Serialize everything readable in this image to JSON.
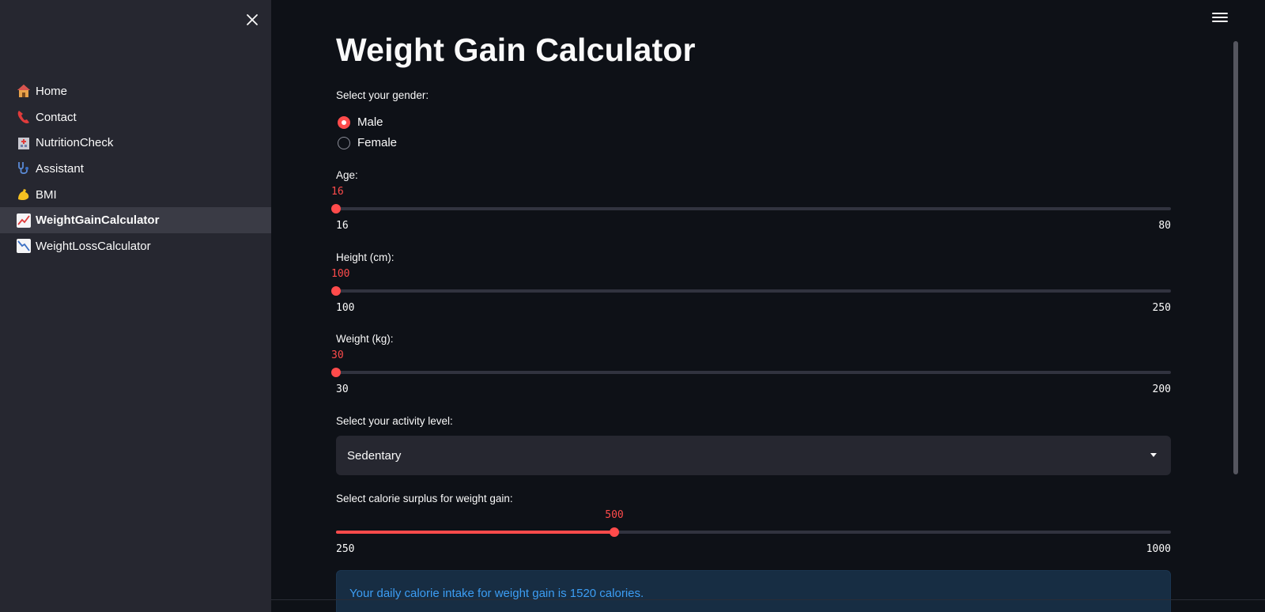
{
  "sidebar": {
    "items": [
      {
        "label": "Home",
        "icon": "house-icon",
        "active": false
      },
      {
        "label": "Contact",
        "icon": "telephone-icon",
        "active": false
      },
      {
        "label": "NutritionCheck",
        "icon": "hospital-icon",
        "active": false
      },
      {
        "label": "Assistant",
        "icon": "stethoscope-icon",
        "active": false
      },
      {
        "label": "BMI",
        "icon": "flexed-biceps-icon",
        "active": false
      },
      {
        "label": "WeightGainCalculator",
        "icon": "chart-increasing-icon",
        "active": true
      },
      {
        "label": "WeightLossCalculator",
        "icon": "chart-decreasing-icon",
        "active": false
      }
    ]
  },
  "main": {
    "title": "Weight Gain Calculator",
    "gender": {
      "label": "Select your gender:",
      "options": [
        "Male",
        "Female"
      ],
      "selected": "Male"
    },
    "age": {
      "label": "Age:",
      "value": "16",
      "min": "16",
      "max": "80"
    },
    "height": {
      "label": "Height (cm):",
      "value": "100",
      "min": "100",
      "max": "250"
    },
    "weight": {
      "label": "Weight (kg):",
      "value": "30",
      "min": "30",
      "max": "200"
    },
    "activity": {
      "label": "Select your activity level:",
      "selected": "Sedentary"
    },
    "surplus": {
      "label": "Select calorie surplus for weight gain:",
      "value": "500",
      "min": "250",
      "max": "1000"
    },
    "result": "Your daily calorie intake for weight gain is 1520 calories."
  },
  "colors": {
    "accent": "#ff4b4b",
    "background": "#0e1117",
    "sidebar": "#262730",
    "info_text": "#3d9df3"
  }
}
